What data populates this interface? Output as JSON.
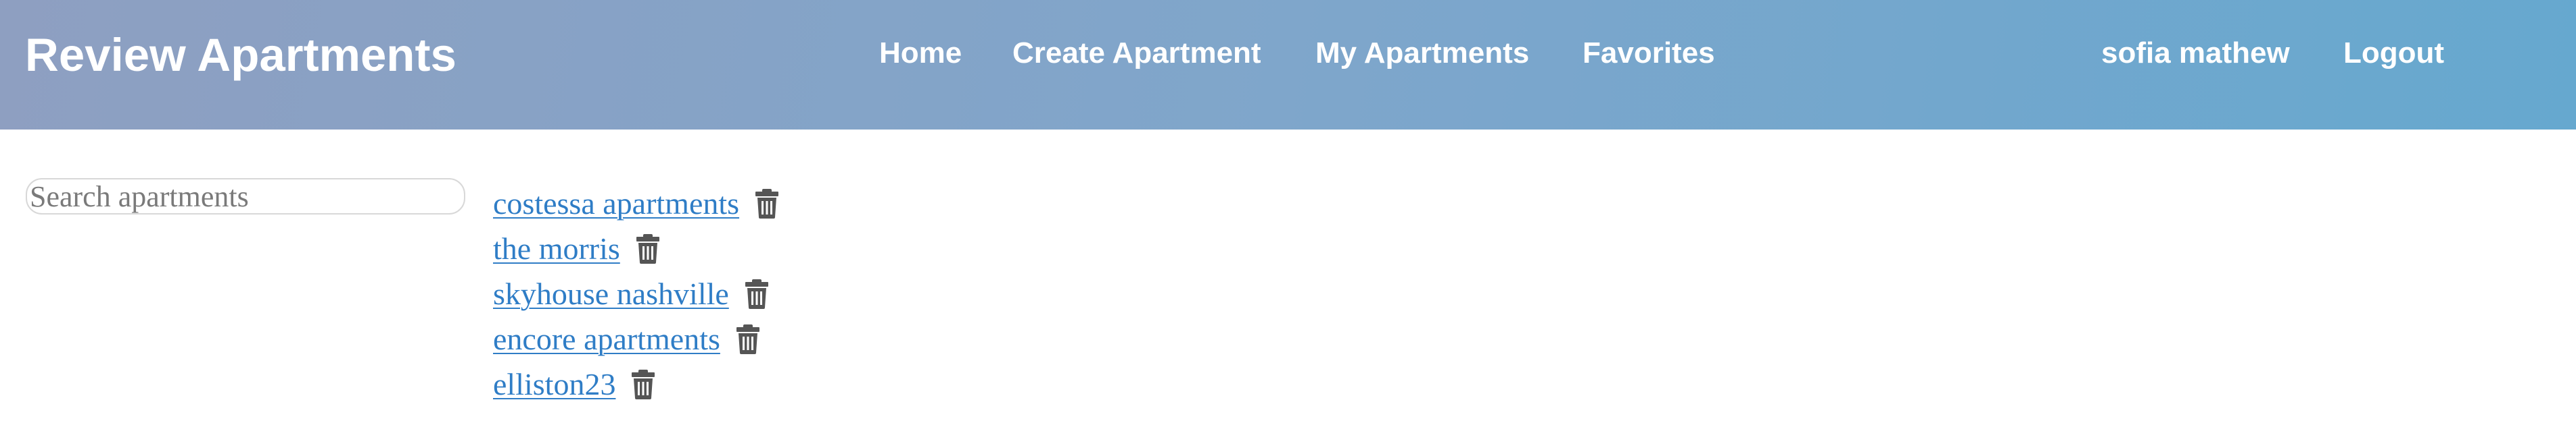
{
  "header": {
    "brand": "Review Apartments",
    "nav": [
      {
        "label": "Home"
      },
      {
        "label": "Create Apartment"
      },
      {
        "label": "My Apartments"
      },
      {
        "label": "Favorites"
      }
    ],
    "user": {
      "name": "sofia mathew",
      "logout_label": "Logout"
    }
  },
  "search": {
    "placeholder": "Search apartments",
    "value": ""
  },
  "apartments": [
    {
      "name": "costessa apartments"
    },
    {
      "name": "the morris"
    },
    {
      "name": "skyhouse nashville"
    },
    {
      "name": "encore apartments"
    },
    {
      "name": "elliston23"
    }
  ],
  "colors": {
    "header_gradient_start": "#8e9fc1",
    "header_gradient_end": "#66a8cf",
    "link": "#2f7dc6",
    "icon": "#555555"
  },
  "icons": {
    "delete": "trash-icon"
  }
}
